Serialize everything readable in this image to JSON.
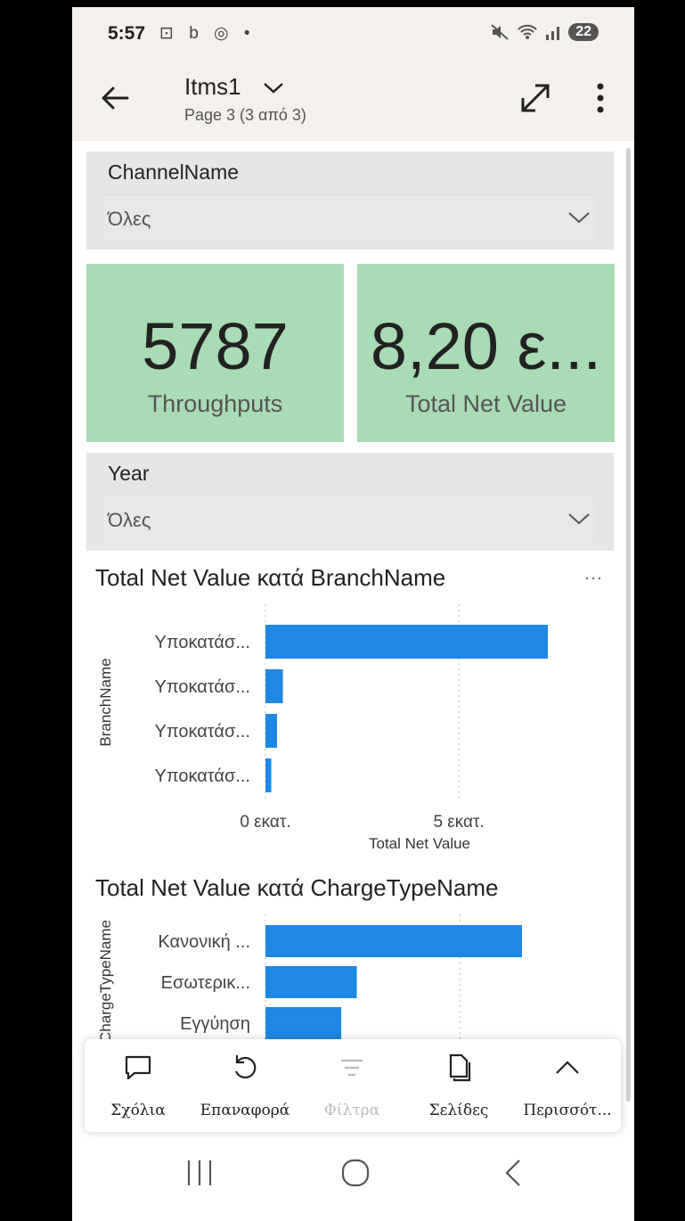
{
  "status_bar": {
    "time": "5:57",
    "left_icons": "⊡ b ◎ •",
    "battery": "22"
  },
  "header": {
    "title": "Itms1",
    "subtitle": "Page 3 (3 από 3)"
  },
  "slicers": [
    {
      "label": "ChannelName",
      "value": "Όλες"
    },
    {
      "label": "Year",
      "value": "Όλες"
    }
  ],
  "cards": [
    {
      "value": "5787",
      "label": "Throughputs"
    },
    {
      "value": "8,20 ε...",
      "label": "Total Net Value"
    }
  ],
  "chart_data": [
    {
      "type": "bar",
      "orientation": "horizontal",
      "title": "Total Net Value κατά BranchName",
      "ylabel": "BranchName",
      "xlabel": "Total Net Value",
      "categories": [
        "Υποκατάσ...",
        "Υποκατάσ...",
        "Υποκατάσ...",
        "Υποκατάσ..."
      ],
      "values": [
        7.3,
        0.45,
        0.3,
        0.15
      ],
      "xlim": [
        0,
        7.3
      ],
      "x_ticks": [
        0,
        5
      ],
      "x_tick_labels": [
        "0 εκατ.",
        "5 εκατ."
      ],
      "bar_color": "#1e88e5",
      "grid": true
    },
    {
      "type": "bar",
      "orientation": "horizontal",
      "title": "Total Net Value κατά ChargeTypeName",
      "ylabel": "ChargeTypeName",
      "xlabel": "",
      "categories": [
        "Κανονική ...",
        "Εσωτερικ...",
        "Εγγύηση"
      ],
      "values": [
        6.6,
        2.35,
        1.95
      ],
      "xlim": [
        0,
        6.6
      ],
      "x_ticks": [
        5
      ],
      "x_tick_labels": [],
      "bar_color": "#1e88e5",
      "grid": true
    }
  ],
  "chart_more_label": "···",
  "bottom_bar": {
    "items": [
      {
        "label": "Σχόλια",
        "icon": "comment-icon",
        "enabled": true
      },
      {
        "label": "Επαναφορά",
        "icon": "reset-icon",
        "enabled": true
      },
      {
        "label": "Φίλτρα",
        "icon": "filter-icon",
        "enabled": false
      },
      {
        "label": "Σελίδες",
        "icon": "pages-icon",
        "enabled": true
      },
      {
        "label": "Περισσότ...",
        "icon": "chevron-up-icon",
        "enabled": true
      }
    ]
  },
  "colors": {
    "card_bg": "#a7dcb4",
    "slicer_bg": "#e6e6e6",
    "bar": "#1e88e5",
    "header_bg": "#f4f0ec"
  }
}
